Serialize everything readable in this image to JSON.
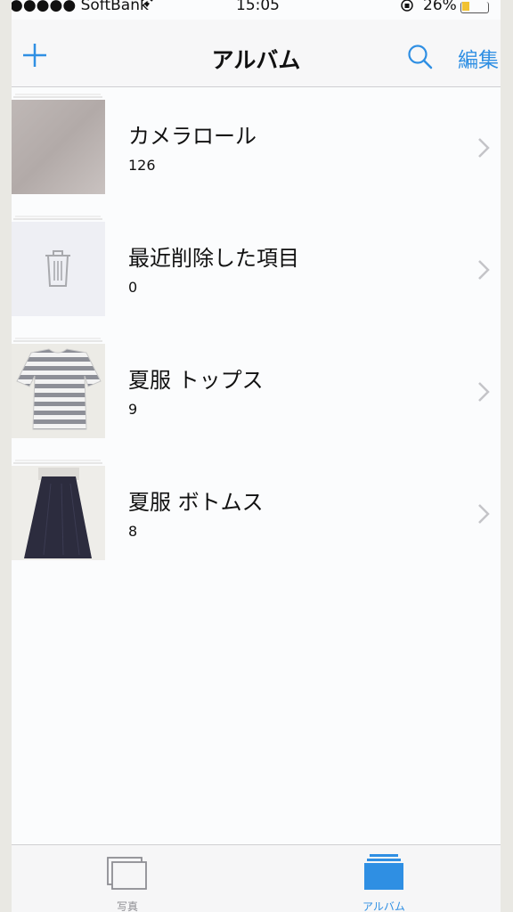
{
  "status_bar": {
    "carrier": "●●●●● SoftBank",
    "time": "15:05",
    "battery_percent": "26%"
  },
  "navbar": {
    "title": "アルバム",
    "edit_label": "編集"
  },
  "albums": [
    {
      "name": "カメラロール",
      "count": "126",
      "thumbnail": "grey-photo"
    },
    {
      "name": "最近削除した項目",
      "count": "0",
      "thumbnail": "trash-icon"
    },
    {
      "name": "夏服 トップス",
      "count": "9",
      "thumbnail": "striped-tshirt-photo"
    },
    {
      "name": "夏服 ボトムス",
      "count": "8",
      "thumbnail": "navy-skirt-photo"
    }
  ],
  "tabbar": {
    "tabs": [
      {
        "label": "写真",
        "active": false
      },
      {
        "label": "アルバム",
        "active": true
      }
    ]
  },
  "colors": {
    "accent": "#2f8fe3",
    "background": "#fbfcfd",
    "navbar": "#f7f7f8"
  }
}
